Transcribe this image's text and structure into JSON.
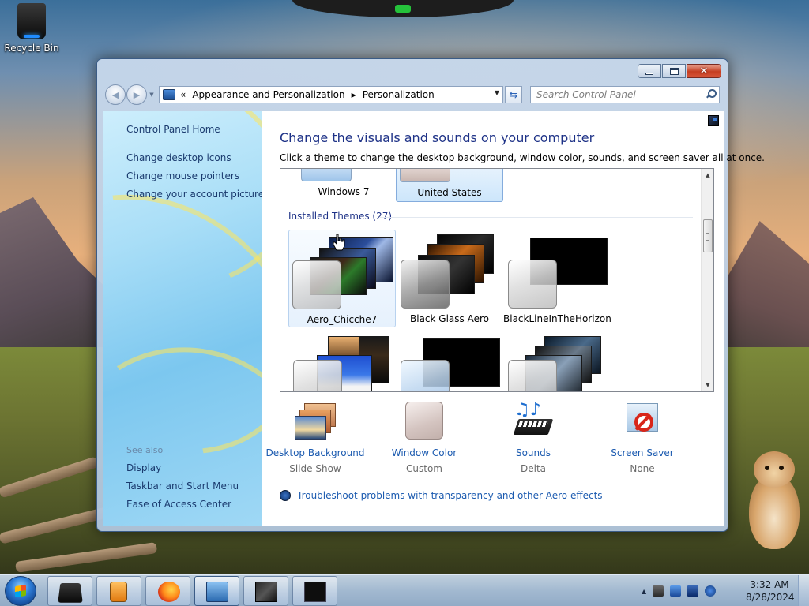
{
  "desktop": {
    "recycle_bin_label": "Recycle Bin"
  },
  "window": {
    "address": {
      "chevron": "«",
      "crumbs": [
        "Appearance and Personalization",
        "Personalization"
      ]
    },
    "search_placeholder": "Search Control Panel",
    "left_pane": {
      "home": "Control Panel Home",
      "tasks": [
        "Change desktop icons",
        "Change mouse pointers",
        "Change your account picture"
      ],
      "see_also_heading": "See also",
      "see_also": [
        "Display",
        "Taskbar and Start Menu",
        "Ease of Access Center"
      ]
    },
    "main": {
      "title": "Change the visuals and sounds on your computer",
      "subtitle": "Click a theme to change the desktop background, window color, sounds, and screen saver all at once.",
      "top_themes": [
        "Windows 7",
        "United States"
      ],
      "installed_header": "Installed Themes (27)",
      "installed_themes": [
        "Aero_Chicche7",
        "Black Glass Aero",
        "BlackLineInTheHorizon"
      ],
      "bottom": [
        {
          "label": "Desktop Background",
          "value": "Slide Show"
        },
        {
          "label": "Window Color",
          "value": "Custom"
        },
        {
          "label": "Sounds",
          "value": "Delta"
        },
        {
          "label": "Screen Saver",
          "value": "None"
        }
      ],
      "troubleshoot": "Troubleshoot problems with transparency and other Aero effects"
    }
  },
  "taskbar": {
    "time": "3:32 AM",
    "date": "8/28/2024"
  },
  "colors": {
    "link_blue": "#1c5bb0",
    "title_blue": "#1e3287",
    "close_red": "#c53e22"
  }
}
